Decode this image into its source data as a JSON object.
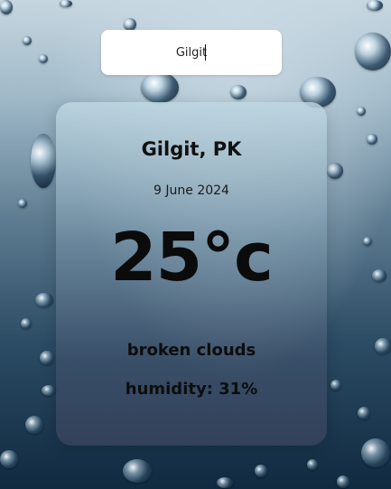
{
  "search": {
    "value": "Gilgit",
    "placeholder": ""
  },
  "weather": {
    "location": "Gilgit, PK",
    "date": "9 June 2024",
    "temperature": "25°c",
    "description": "broken clouds",
    "humidity": "humidity: 31%"
  },
  "colors": {
    "card_background": "#aabfcc",
    "text": "#111111",
    "search_background": "#ffffff"
  }
}
